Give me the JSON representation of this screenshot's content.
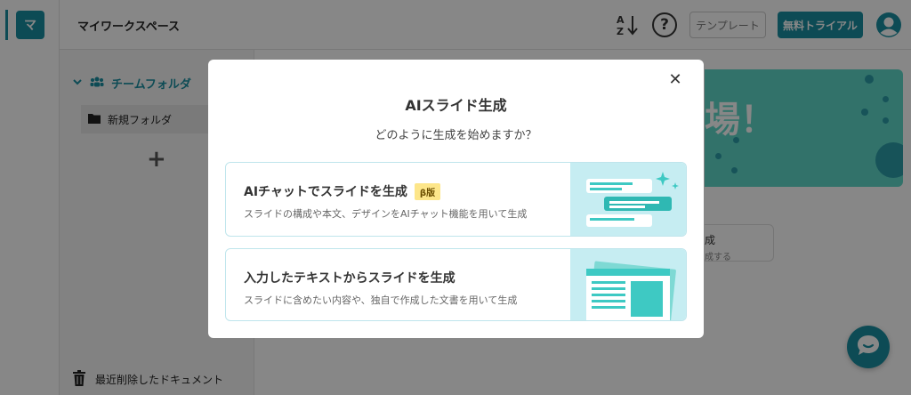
{
  "rail": {
    "avatar_letter": "マ"
  },
  "topbar": {
    "workspace_title": "マイワークスペース",
    "template_label": "テンプレート",
    "trial_label": "無料トライアル"
  },
  "sidebar": {
    "team_folder_label": "チームフォルダ",
    "new_folder_label": "新規フォルダ",
    "add_label": "+",
    "trash_label": "最近削除したドキュメント"
  },
  "background": {
    "banner_text": "場！",
    "card_line1": "成",
    "card_line2": "成する"
  },
  "modal": {
    "title": "AIスライド生成",
    "subtitle": "どのように生成を始めますか？",
    "close_symbol": "✕",
    "options": [
      {
        "title": "AIチャットでスライドを生成",
        "badge": "β版",
        "description": "スライドの構成や本文、デザインをAIチャット機能を用いて生成"
      },
      {
        "title": "入力したテキストからスライドを生成",
        "description": "スライドに含めたい内容や、独自で作成した文書を用いて生成"
      }
    ]
  },
  "colors": {
    "brand": "#1a8fa0",
    "accent_light": "#c6edf2",
    "badge": "#fde68a"
  }
}
